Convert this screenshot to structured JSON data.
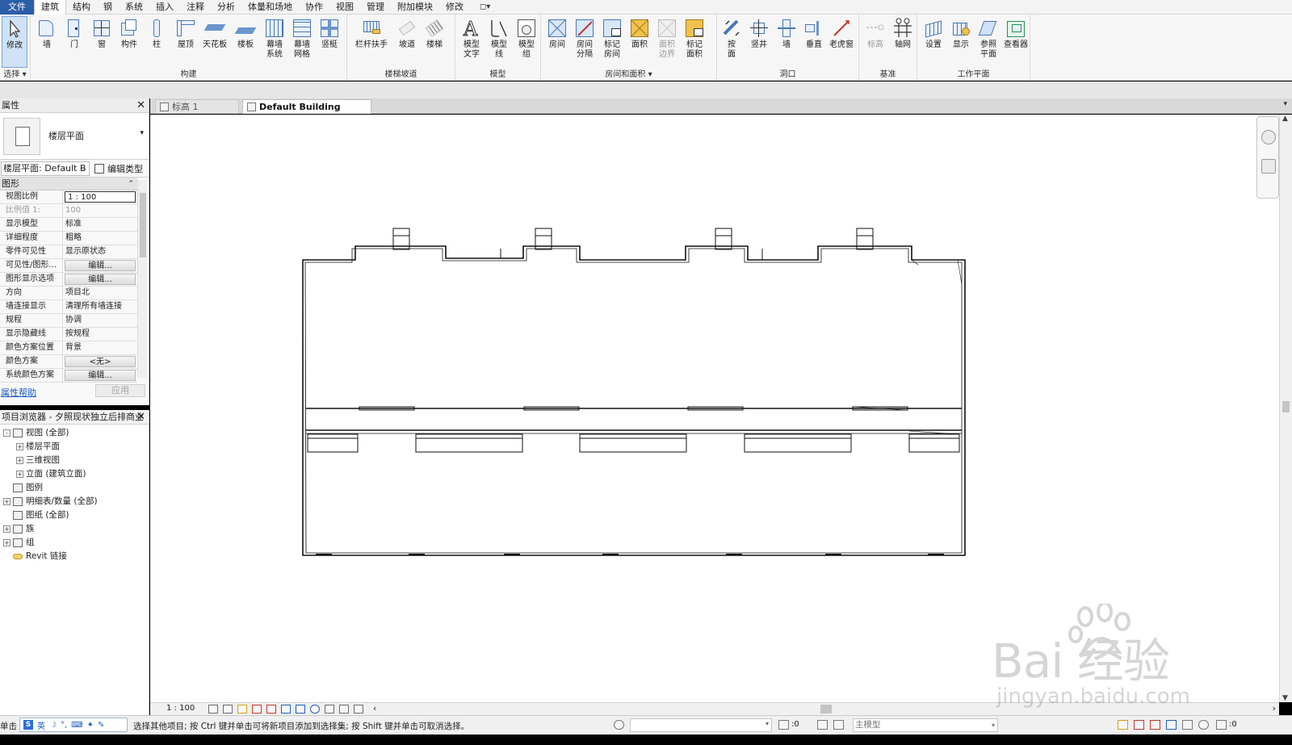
{
  "menu": {
    "items": [
      "文件",
      "建筑",
      "结构",
      "钢",
      "系统",
      "插入",
      "注释",
      "分析",
      "体量和场地",
      "协作",
      "视图",
      "管理",
      "附加模块",
      "修改"
    ],
    "active_index": 1
  },
  "ribbon": {
    "select": {
      "tool": "修改",
      "group": "选择"
    },
    "build": {
      "group": "构建",
      "tools": [
        "墙",
        "门",
        "窗",
        "构件",
        "柱",
        "屋顶",
        "天花板",
        "楼板",
        "幕墙\n系统",
        "幕墙\n网格",
        "竖梃"
      ]
    },
    "circulation": {
      "group": "楼梯坡道",
      "tools": [
        "栏杆扶手",
        "坡道",
        "楼梯"
      ]
    },
    "model": {
      "group": "模型",
      "tools": [
        "模型\n文字",
        "模型\n线",
        "模型\n组"
      ]
    },
    "room_area": {
      "group": "房间和面积",
      "tools": [
        "房间",
        "房间\n分隔",
        "标记\n房间",
        "面积",
        "面积\n边界",
        "标记\n面积"
      ]
    },
    "opening": {
      "group": "洞口",
      "tools": [
        "按\n面",
        "竖井",
        "墙",
        "垂直",
        "老虎窗"
      ]
    },
    "datum": {
      "group": "基准",
      "tools": [
        "标高",
        "轴网"
      ]
    },
    "work_plane": {
      "group": "工作平面",
      "tools": [
        "设置",
        "显示",
        "参照\n平面",
        "查看器"
      ]
    }
  },
  "properties": {
    "title": "属性",
    "type_name": "楼层平面",
    "instance_selector": "楼层平面: Default B",
    "edit_type": "编辑类型",
    "section": "图形",
    "rows": [
      {
        "name": "视图比例",
        "value": "1 : 100",
        "kind": "input"
      },
      {
        "name": "比例值 1:",
        "value": "100",
        "kind": "dim"
      },
      {
        "name": "显示模型",
        "value": "标准",
        "kind": "text"
      },
      {
        "name": "详细程度",
        "value": "粗略",
        "kind": "text"
      },
      {
        "name": "零件可见性",
        "value": "显示原状态",
        "kind": "text"
      },
      {
        "name": "可见性/图形...",
        "value": "编辑...",
        "kind": "button"
      },
      {
        "name": "图形显示选项",
        "value": "编辑...",
        "kind": "button"
      },
      {
        "name": "方向",
        "value": "项目北",
        "kind": "text"
      },
      {
        "name": "墙连接显示",
        "value": "清理所有墙连接",
        "kind": "text"
      },
      {
        "name": "规程",
        "value": "协调",
        "kind": "text"
      },
      {
        "name": "显示隐藏线",
        "value": "按规程",
        "kind": "text"
      },
      {
        "name": "颜色方案位置",
        "value": "背景",
        "kind": "text"
      },
      {
        "name": "颜色方案",
        "value": "<无>",
        "kind": "button"
      },
      {
        "name": "系统颜色方案",
        "value": "编辑...",
        "kind": "button"
      }
    ],
    "help_link": "属性帮助",
    "apply": "应用"
  },
  "browser": {
    "title": "项目浏览器 - 夕照现状独立后排商业",
    "items": [
      {
        "label": "视图 (全部)",
        "level": 0,
        "toggle": "-",
        "icon": true
      },
      {
        "label": "楼层平面",
        "level": 1,
        "toggle": "+",
        "icon": false
      },
      {
        "label": "三维视图",
        "level": 1,
        "toggle": "+",
        "icon": false
      },
      {
        "label": "立面 (建筑立面)",
        "level": 1,
        "toggle": "+",
        "icon": false
      },
      {
        "label": "图例",
        "level": 0,
        "toggle": "",
        "icon": true
      },
      {
        "label": "明细表/数量 (全部)",
        "level": 0,
        "toggle": "+",
        "icon": true
      },
      {
        "label": "图纸 (全部)",
        "level": 0,
        "toggle": "",
        "icon": true
      },
      {
        "label": "族",
        "level": 0,
        "toggle": "+",
        "icon": true
      },
      {
        "label": "组",
        "level": 0,
        "toggle": "+",
        "icon": true
      },
      {
        "label": "Revit 链接",
        "level": 0,
        "toggle": "",
        "icon": "link"
      }
    ]
  },
  "tabs": [
    {
      "label": "标高 1",
      "active": false
    },
    {
      "label": "Default Building Storey",
      "active": true,
      "close": "✕"
    }
  ],
  "view_control": {
    "scale": "1 : 100"
  },
  "status": {
    "left_text": "单击",
    "message": "选择其他项目; 按 Ctrl 键并单击可将新项目添加到选择集; 按 Shift 键并单击可取消选择。",
    "ime_lang": "英",
    "selection_count": ":0",
    "model_combo": "主模型",
    "filter_count": ":0"
  },
  "watermark": {
    "brand": "Bai  经验",
    "site": "jingyan.baidu.com"
  }
}
